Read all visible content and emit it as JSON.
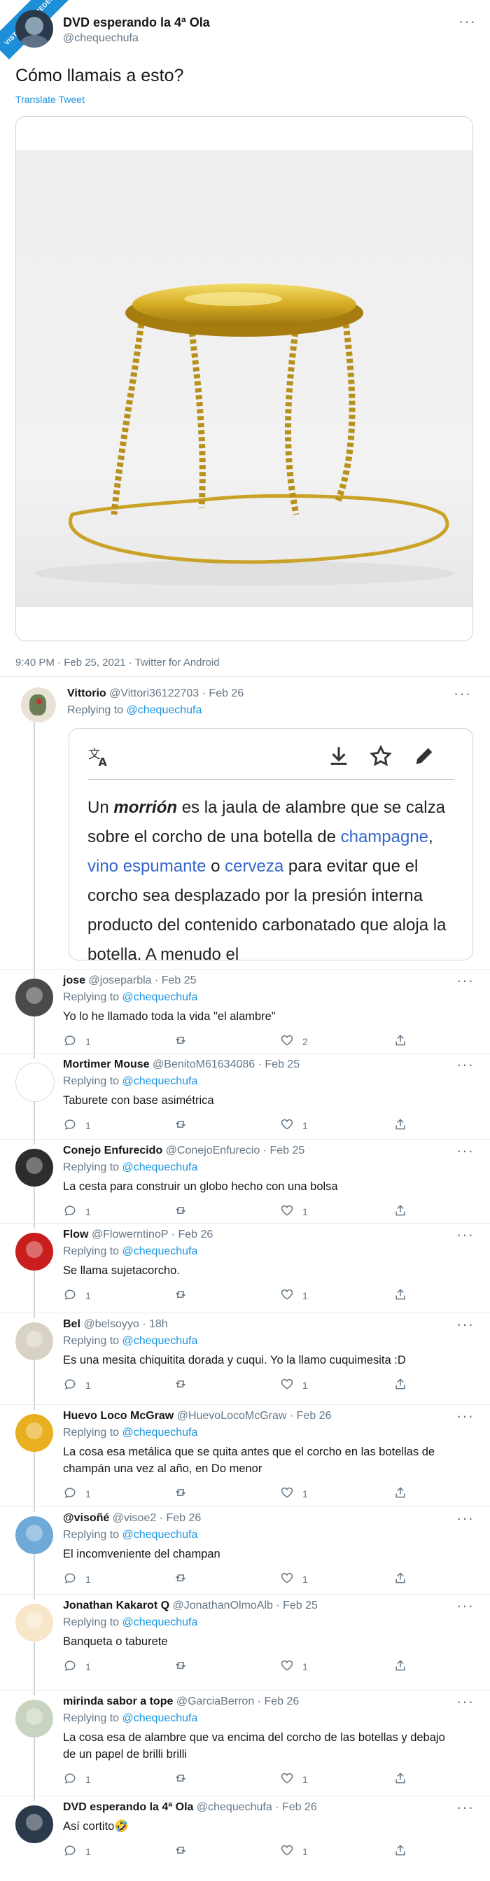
{
  "watermark": "VISTOENLASREDES",
  "main_tweet": {
    "author_name": "DVD esperando la 4ª Ola",
    "author_handle": "@chequechufa",
    "text": "Cómo llamais a esto?",
    "translate": "Translate Tweet",
    "meta": "9:40 PM · Feb 25, 2021 · Twitter for Android"
  },
  "vittorio": {
    "name": "Vittorio",
    "handle_date": "@Vittori36122703 · Feb 26",
    "replying_prefix": "Replying to ",
    "replying_to": "@chequechufa",
    "card": {
      "w_un": "Un ",
      "w_morrion": "morrión",
      "w_a": " es la jaula de alambre que se calza sobre el corcho de una botella de ",
      "w_champagne": "champagne",
      "w_comma": ", ",
      "w_vino": "vino espumante",
      "w_o": " o ",
      "w_cerveza": "cerveza",
      "w_rest": " para evitar que el corcho sea desplazado por la presión interna producto del contenido carbonatado que aloja la botella. A menudo el"
    }
  },
  "replies": [
    {
      "name": "jose",
      "handle_date": "@joseparbla · Feb 25",
      "replying_prefix": "Replying to ",
      "replying_to": "@chequechufa",
      "text": "Yo lo he llamado toda la vida \"el alambre\"",
      "replies": "1",
      "likes": "2"
    },
    {
      "name": "Mortimer Mouse",
      "handle_date": "@BenitoM61634086 · Feb 25",
      "replying_prefix": "Replying to ",
      "replying_to": "@chequechufa",
      "text": "Taburete con base asimétrica",
      "replies": "1",
      "likes": "1"
    },
    {
      "name": "Conejo Enfurecido",
      "handle_date": "@ConejoEnfurecio · Feb 25",
      "replying_prefix": "Replying to ",
      "replying_to": "@chequechufa",
      "text": "La cesta para construir un globo hecho con una bolsa",
      "replies": "1",
      "likes": "1"
    },
    {
      "name": "Flow",
      "handle_date": "@FlowerntinoP · Feb 26",
      "replying_prefix": "Replying to ",
      "replying_to": "@chequechufa",
      "text": "Se llama sujetacorcho.",
      "replies": "1",
      "likes": "1"
    },
    {
      "name": "Bel",
      "handle_date": "@belsoyyo · 18h",
      "replying_prefix": "Replying to ",
      "replying_to": "@chequechufa",
      "text": "Es una mesita chiquitita dorada y cuqui. Yo la llamo cuquimesita :D",
      "replies": "1",
      "likes": "1"
    },
    {
      "name": "Huevo Loco McGraw",
      "handle_date": "@HuevoLocoMcGraw · Feb 26",
      "replying_prefix": "Replying to ",
      "replying_to": "@chequechufa",
      "text": "La cosa esa metálica que se quita antes que el corcho en las botellas de champán una vez al año, en Do menor",
      "replies": "1",
      "likes": "1"
    },
    {
      "name": "@visoñé",
      "handle_date": "@visoe2 · Feb 26",
      "replying_prefix": "Replying to ",
      "replying_to": "@chequechufa",
      "text": "El incomveniente del champan",
      "replies": "1",
      "likes": "1"
    },
    {
      "name": "Jonathan Kakarot Q",
      "handle_date": "@JonathanOlmoAlb · Feb 25",
      "replying_prefix": "Replying to ",
      "replying_to": "@chequechufa",
      "text": "Banqueta o taburete",
      "replies": "1",
      "likes": "1"
    },
    {
      "name": "mirinda sabor a tope",
      "handle_date": "@GarciaBerron · Feb 26",
      "replying_prefix": "Replying to ",
      "replying_to": "@chequechufa",
      "text": "La cosa esa de alambre que va encima del corcho de las botellas y debajo de un papel de brilli brilli",
      "replies": "1",
      "likes": "1"
    },
    {
      "name": "DVD esperando la 4ª Ola",
      "handle_date": "@chequechufa · Feb 26",
      "replying_prefix": "",
      "replying_to": "",
      "text": "Así cortito🤣",
      "replies": "1",
      "likes": "1"
    }
  ],
  "colors": {
    "link": "#1b95e0",
    "muted": "#657786",
    "border": "#e6ecf0",
    "gold": "#c9a227"
  }
}
